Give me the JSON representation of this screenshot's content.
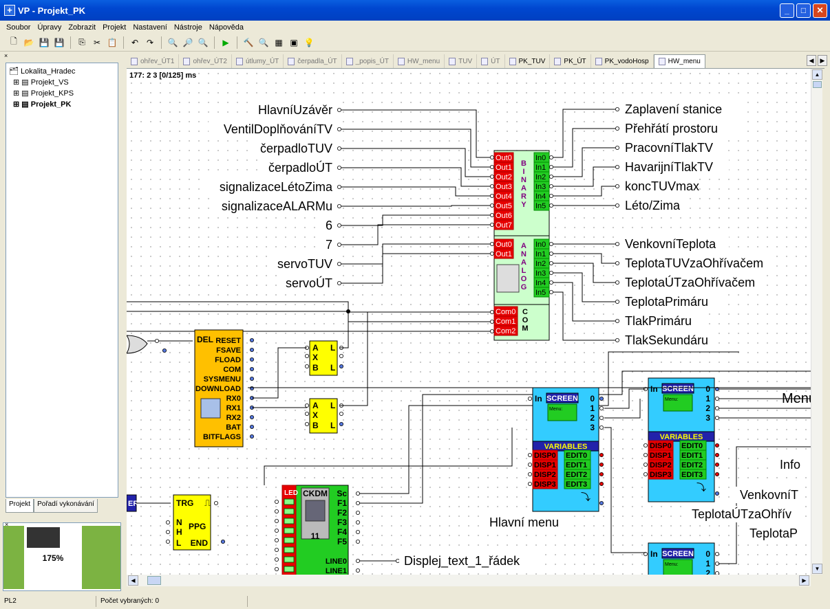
{
  "window": {
    "title": "VP - Projekt_PK",
    "min": "_",
    "max": "□",
    "close": "✕"
  },
  "menu": [
    "Soubor",
    "Úpravy",
    "Zobrazit",
    "Projekt",
    "Nastavení",
    "Nástroje",
    "Nápověda"
  ],
  "tree": {
    "root": "Lokalita_Hradec",
    "items": [
      "Projekt_VS",
      "Projekt_KPS",
      "Projekt_PK"
    ]
  },
  "left_tabs": [
    "Projekt",
    "Pořadí vykonávání"
  ],
  "minimap": {
    "zoom": "175%"
  },
  "doc_tabs": [
    "ohřev_ÚT1",
    "ohřev_ÚT2",
    "útlumy_ÚT",
    "čerpadla_ÚT",
    "_popis_ÚT",
    "HW_menu",
    "TUV",
    "ÚT",
    "PK_TUV",
    "PK_ÚT",
    "PK_vodoHosp",
    "HW_menu"
  ],
  "canvas": {
    "coord": "177: 2 3 [0/125] ms"
  },
  "left_labels": [
    "HlavníUzávěr",
    "VentilDoplňováníTV",
    "čerpadloTUV",
    "čerpadloÚT",
    "signalizaceLétoZima",
    "signalizaceALARMu",
    "6",
    "7",
    "servoTUV",
    "servoÚT"
  ],
  "right_labels": [
    "Zaplavení stanice",
    "Přehřátí prostoru",
    "PracovníTlakTV",
    "HavarijníTlakTV",
    "koncTUVmax",
    "Léto/Zima",
    "VenkovníTeplota",
    "TeplotaTUVzaOhřívačem",
    "TeplotaÚTzaOhřívačem",
    "TeplotaPrimáru",
    "TlakPrimáru",
    "TlakSekundáru"
  ],
  "io_block": {
    "binary_title": "BINARY",
    "analog_title": "ANALOG",
    "com_title": "COM",
    "b_out": [
      "Out0",
      "Out1",
      "Out2",
      "Out3",
      "Out4",
      "Out5",
      "Out6",
      "Out7"
    ],
    "b_in": [
      "In0",
      "In1",
      "In2",
      "In3",
      "In4",
      "In5"
    ],
    "a_out": [
      "Out0",
      "Out1"
    ],
    "a_in": [
      "In0",
      "In1",
      "In2",
      "In3",
      "In4",
      "In5"
    ],
    "com": [
      "Com0",
      "Com1",
      "Com2"
    ]
  },
  "sys_block": {
    "del": "DEL",
    "pins": [
      "RESET",
      "FSAVE",
      "FLOAD",
      "COM",
      "SYSMENU",
      "DOWNLOAD",
      "RX0",
      "RX1",
      "RX2",
      "BAT",
      "BITFLAGS"
    ]
  },
  "timer_block": {
    "a": "A",
    "x": "X",
    "b": "B",
    "l": "L"
  },
  "ppg_block": {
    "trg": "TRG",
    "n": "N",
    "h": "H",
    "l": "L",
    "end": "END",
    "name": "PPG"
  },
  "ckdm": {
    "led": "LED",
    "title": "CKDM",
    "num": "11",
    "out": [
      "Sc",
      "F1",
      "F2",
      "F3",
      "F4",
      "F5"
    ],
    "lines": [
      "LINE0",
      "LINE1"
    ]
  },
  "screen1": {
    "in": "In",
    "title": "SCREEN",
    "menu": "Menu:",
    "outs": [
      "0",
      "1",
      "2",
      "3"
    ],
    "variables": "VARIABLES",
    "disp": [
      "DISP0",
      "DISP1",
      "DISP2",
      "DISP3"
    ],
    "edit": [
      "EDIT0",
      "EDIT1",
      "EDIT2",
      "EDIT3"
    ],
    "label": "Hlavní menu"
  },
  "screen2": {
    "in": "In",
    "title": "SCREEN",
    "menu": "Menu:",
    "outs": [
      "0",
      "1",
      "2",
      "3"
    ],
    "variables": "VARIABLES",
    "disp": [
      "DISP0",
      "DISP1",
      "DISP2",
      "DISP3"
    ],
    "edit": [
      "EDIT0",
      "EDIT1",
      "EDIT2",
      "EDIT3"
    ],
    "label": "Menu"
  },
  "screen3": {
    "in": "In",
    "title": "SCREEN",
    "menu": "Menu:",
    "outs": [
      "0",
      "1",
      "2"
    ]
  },
  "misc_labels": {
    "info": "Info",
    "venk": "VenkovníT",
    "tep_ut": "TeplotaÚTzaOhřív",
    "tep_p": "TeplotaP",
    "displej": "Displej_text_1_řádek",
    "er": "ER"
  },
  "status": {
    "left": "PL2",
    "selected": "Počet vybraných: 0"
  },
  "colors": {
    "canvas_bg": "#ffffff",
    "io_block": "#ccffcc",
    "red": "#e60000",
    "green": "#22cc22",
    "sys_block": "#ffc000",
    "yellow": "#ffff00",
    "screen": "#33ccff"
  }
}
